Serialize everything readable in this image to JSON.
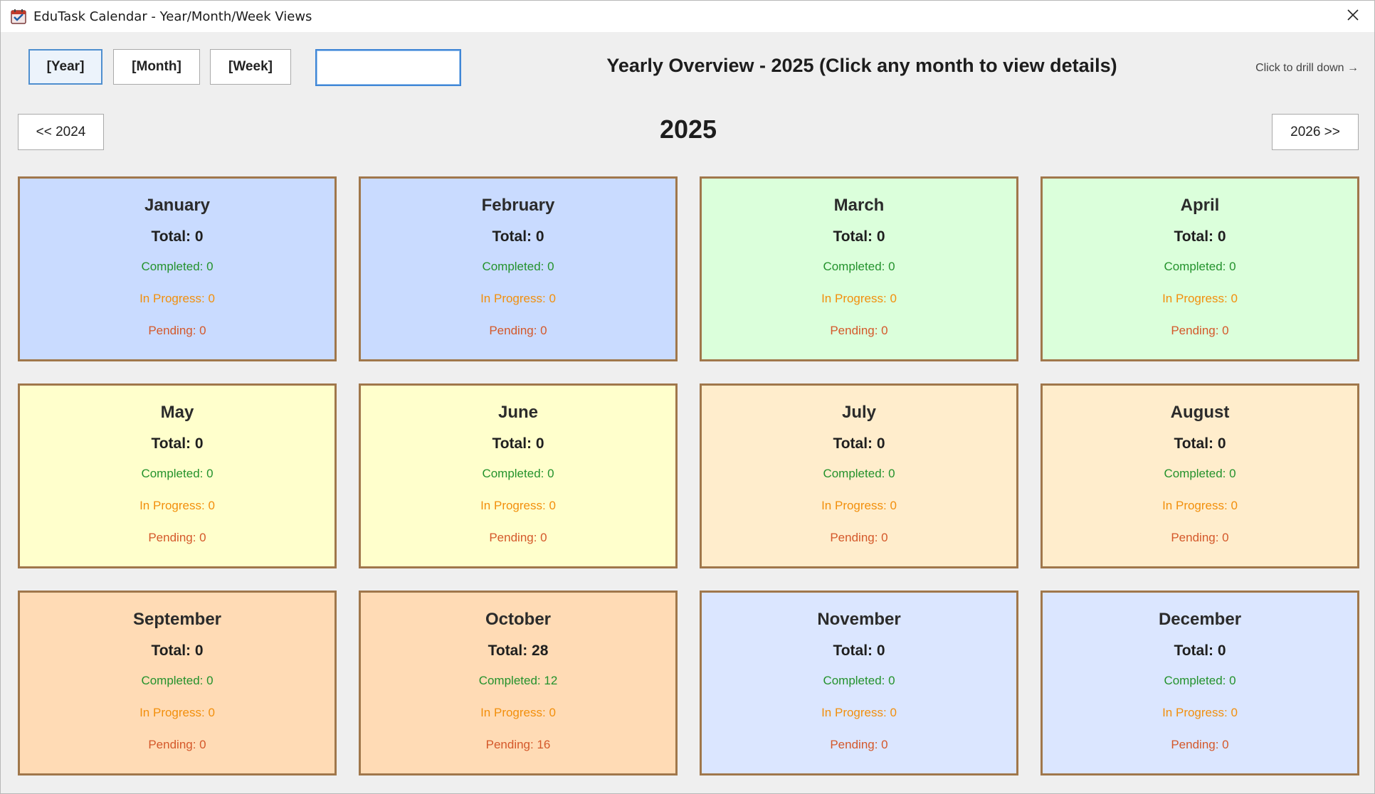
{
  "window": {
    "title": "EduTask Calendar - Year/Month/Week Views",
    "app_icon": "calendar-app-icon",
    "close_icon": "close-icon"
  },
  "toolbar": {
    "year_label": "[Year]",
    "month_label": "[Month]",
    "week_label": "[Week]",
    "blank_field_value": "",
    "overview_title": "Yearly Overview - 2025 (Click any month to view details)",
    "drill_hint": "Click to drill down →"
  },
  "year_nav": {
    "prev_label": "<< 2024",
    "current_year": "2025",
    "next_label": "2026 >>"
  },
  "colors": {
    "winter_blue": "#c9dbff",
    "spring_green": "#dbffdb",
    "summer_yellow": "#ffffcc",
    "summer_peach": "#ffedcc",
    "autumn_orange": "#ffdbb5",
    "late_blue": "#dbe6ff",
    "card_border": "#a0774b",
    "completed_color": "#23922c",
    "in_progress_color": "#f28f0c",
    "pending_color": "#d4582a"
  },
  "months": [
    {
      "name": "January",
      "total": "Total: 0",
      "completed": "Completed: 0",
      "in_progress": "In Progress: 0",
      "pending": "Pending: 0",
      "bg": "#c9dbff"
    },
    {
      "name": "February",
      "total": "Total: 0",
      "completed": "Completed: 0",
      "in_progress": "In Progress: 0",
      "pending": "Pending: 0",
      "bg": "#c9dbff"
    },
    {
      "name": "March",
      "total": "Total: 0",
      "completed": "Completed: 0",
      "in_progress": "In Progress: 0",
      "pending": "Pending: 0",
      "bg": "#dbffdb"
    },
    {
      "name": "April",
      "total": "Total: 0",
      "completed": "Completed: 0",
      "in_progress": "In Progress: 0",
      "pending": "Pending: 0",
      "bg": "#dbffdb"
    },
    {
      "name": "May",
      "total": "Total: 0",
      "completed": "Completed: 0",
      "in_progress": "In Progress: 0",
      "pending": "Pending: 0",
      "bg": "#ffffcc"
    },
    {
      "name": "June",
      "total": "Total: 0",
      "completed": "Completed: 0",
      "in_progress": "In Progress: 0",
      "pending": "Pending: 0",
      "bg": "#ffffcc"
    },
    {
      "name": "July",
      "total": "Total: 0",
      "completed": "Completed: 0",
      "in_progress": "In Progress: 0",
      "pending": "Pending: 0",
      "bg": "#ffedcc"
    },
    {
      "name": "August",
      "total": "Total: 0",
      "completed": "Completed: 0",
      "in_progress": "In Progress: 0",
      "pending": "Pending: 0",
      "bg": "#ffedcc"
    },
    {
      "name": "September",
      "total": "Total: 0",
      "completed": "Completed: 0",
      "in_progress": "In Progress: 0",
      "pending": "Pending: 0",
      "bg": "#ffdbb5"
    },
    {
      "name": "October",
      "total": "Total: 28",
      "completed": "Completed: 12",
      "in_progress": "In Progress: 0",
      "pending": "Pending: 16",
      "bg": "#ffdbb5"
    },
    {
      "name": "November",
      "total": "Total: 0",
      "completed": "Completed: 0",
      "in_progress": "In Progress: 0",
      "pending": "Pending: 0",
      "bg": "#dbe6ff"
    },
    {
      "name": "December",
      "total": "Total: 0",
      "completed": "Completed: 0",
      "in_progress": "In Progress: 0",
      "pending": "Pending: 0",
      "bg": "#dbe6ff"
    }
  ]
}
